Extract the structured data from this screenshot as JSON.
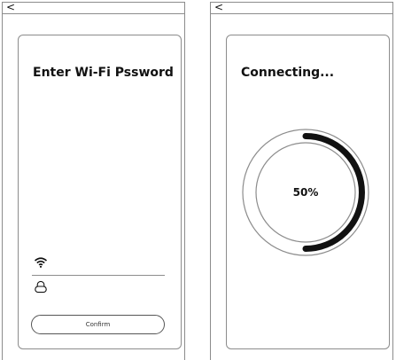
{
  "left_screen": {
    "title": "Enter Wi-Fi Pssword",
    "confirm_label": "Confirm",
    "icons": {
      "back": "back-chevron-icon",
      "wifi": "wifi-icon",
      "lock": "lock-icon"
    }
  },
  "right_screen": {
    "title": "Connecting...",
    "progress": {
      "value_text": "50%",
      "fraction": 0.5
    },
    "icons": {
      "back": "back-chevron-icon"
    }
  },
  "colors": {
    "border": "#8c8c8c",
    "progress_track": "#8c8c8c",
    "progress_fill": "#111111",
    "text": "#111111"
  },
  "glyphs": {
    "back": "<"
  }
}
